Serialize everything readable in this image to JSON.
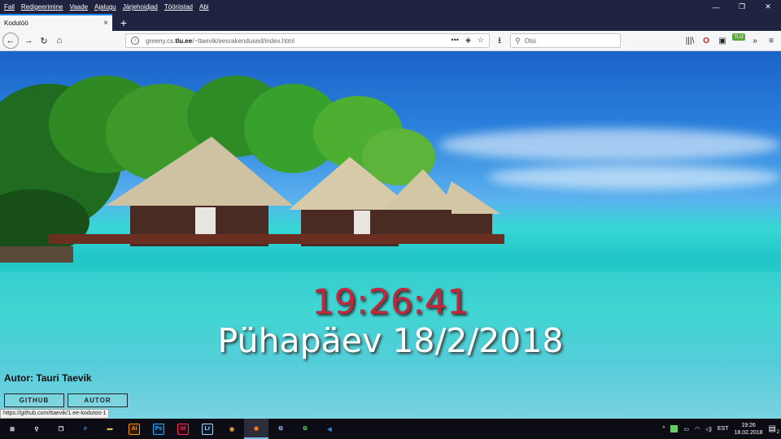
{
  "menu": [
    "Fail",
    "Redigeerimine",
    "Vaade",
    "Ajalugu",
    "Järjehoidjad",
    "Tööriistad",
    "Abi"
  ],
  "window_controls": [
    "—",
    "❐",
    "✕"
  ],
  "tab": {
    "title": "Kodutöö",
    "close": "×"
  },
  "newtab": "+",
  "nav": {
    "back": "←",
    "forward": "→",
    "reload": "↻",
    "home": "⌂"
  },
  "url": {
    "prefix": "greeny.cs.",
    "host": "tlu.ee",
    "path": "/~ttaevik/eesrakendused/index.html",
    "actions": [
      "•••",
      "◈",
      "☆"
    ]
  },
  "search": {
    "placeholder": "Otsi"
  },
  "toolbar_right": {
    "download": "⭳",
    "library": "|||\\",
    "opera": "O",
    "reader": "▣",
    "tlu": "TLÜ",
    "overflow": "»",
    "menu": "≡"
  },
  "page": {
    "time": "19:26:41",
    "date": "Pühapäev 18/2/2018",
    "author": "Autor: Tauri Taevik",
    "buttons": {
      "github": "GITHUB",
      "autor": "AUTOR"
    },
    "status_url": "https://github.com/ttaevik/1.ee-kodutoo-1"
  },
  "taskbar": {
    "apps": [
      {
        "name": "windows-start-icon",
        "label": "⊞",
        "color": "#ffffff",
        "bg": "transparent"
      },
      {
        "name": "search-icon",
        "label": "⚲",
        "color": "#ffffff",
        "bg": "transparent"
      },
      {
        "name": "task-view-icon",
        "label": "❐",
        "color": "#ffffff",
        "bg": "transparent"
      },
      {
        "name": "edge-icon",
        "label": "e",
        "color": "#2e8fe6",
        "bg": "transparent"
      },
      {
        "name": "file-explorer-icon",
        "label": "▬",
        "color": "#f4c542",
        "bg": "transparent"
      },
      {
        "name": "illustrator-icon",
        "label": "Ai",
        "color": "#ff9a00",
        "bg": "#2f1a00"
      },
      {
        "name": "photoshop-icon",
        "label": "Ps",
        "color": "#31a8ff",
        "bg": "#001d34"
      },
      {
        "name": "indesign-icon",
        "label": "Id",
        "color": "#ff3366",
        "bg": "#2b0010"
      },
      {
        "name": "lightroom-icon",
        "label": "Lr",
        "color": "#add5ec",
        "bg": "#001a2b"
      },
      {
        "name": "chrome-icon",
        "label": "◉",
        "color": "#e9a23b",
        "bg": "transparent"
      },
      {
        "name": "firefox-icon",
        "label": "◉",
        "color": "#ff7a1a",
        "bg": "transparent"
      },
      {
        "name": "network-app-icon",
        "label": "⧉",
        "color": "#8fb3ff",
        "bg": "transparent"
      },
      {
        "name": "remote-app-icon",
        "label": "⧉",
        "color": "#5fbf5f",
        "bg": "transparent"
      },
      {
        "name": "vscode-icon",
        "label": "◀",
        "color": "#2a8ae0",
        "bg": "transparent"
      }
    ],
    "tray": {
      "chevron": "^",
      "lang": "EST",
      "time": "19:26",
      "date": "18.02.2018",
      "notif": "2"
    }
  }
}
